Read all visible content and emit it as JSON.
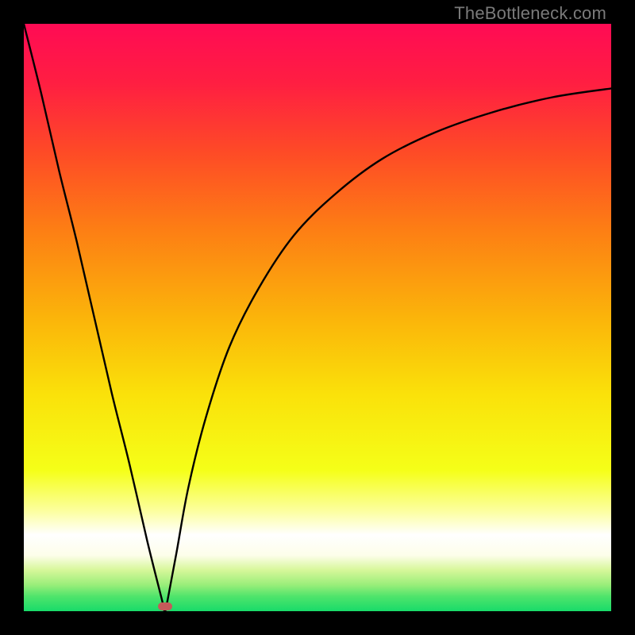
{
  "watermark": "TheBottleneck.com",
  "marker": {
    "x_pct": 24,
    "y_pct": 99.2,
    "color": "#c55a5a"
  },
  "gradient_stops": [
    {
      "offset": 0,
      "color": "#ff0b54"
    },
    {
      "offset": 0.1,
      "color": "#ff1e42"
    },
    {
      "offset": 0.22,
      "color": "#fe4b26"
    },
    {
      "offset": 0.35,
      "color": "#fd7e14"
    },
    {
      "offset": 0.5,
      "color": "#fbb40a"
    },
    {
      "offset": 0.63,
      "color": "#fae10a"
    },
    {
      "offset": 0.76,
      "color": "#f5ff18"
    },
    {
      "offset": 0.83,
      "color": "#fcffa0"
    },
    {
      "offset": 0.87,
      "color": "#ffffff"
    },
    {
      "offset": 0.905,
      "color": "#fdfeea"
    },
    {
      "offset": 0.93,
      "color": "#d6f79a"
    },
    {
      "offset": 0.955,
      "color": "#9aee7a"
    },
    {
      "offset": 0.975,
      "color": "#4fe46b"
    },
    {
      "offset": 1.0,
      "color": "#18db6a"
    }
  ],
  "chart_data": {
    "type": "line",
    "title": "",
    "xlabel": "",
    "ylabel": "",
    "x_range_pct": [
      0,
      100
    ],
    "y_range_pct": [
      0,
      100
    ],
    "note": "V-shaped bottleneck curve. x and y given as percentages of the plot area (0=left/bottom, 100=right/top). Minimum at x≈24, y≈0.",
    "series": [
      {
        "name": "bottleneck-curve",
        "x": [
          0,
          3,
          6,
          9,
          12,
          15,
          18,
          21,
          23.5,
          24,
          24.5,
          26,
          28,
          31,
          35,
          40,
          46,
          53,
          61,
          70,
          80,
          90,
          100
        ],
        "y": [
          100,
          88,
          75,
          63,
          50,
          37,
          25,
          12,
          2,
          0,
          2,
          10,
          21,
          33,
          45,
          55,
          64,
          71,
          77,
          81.5,
          85,
          87.5,
          89
        ]
      }
    ],
    "marker_point": {
      "x": 24,
      "y": 0
    }
  }
}
